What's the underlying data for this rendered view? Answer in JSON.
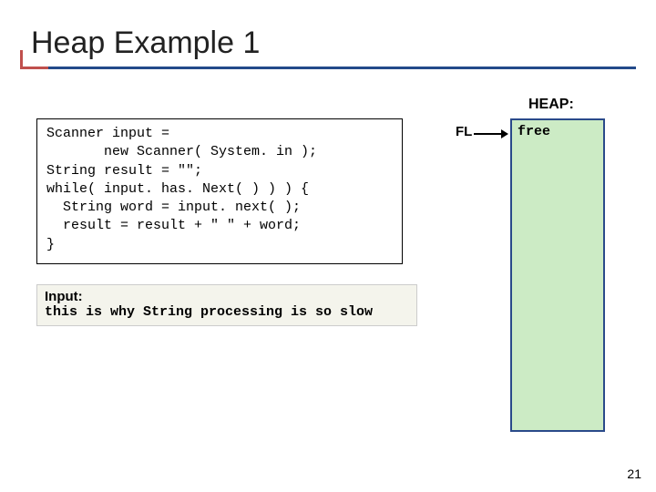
{
  "title": "Heap Example 1",
  "code": {
    "l1": "Scanner input = ",
    "l2": "       new Scanner( System. in );",
    "l3": "String result = \"\";",
    "l4": "while( input. has. Next( ) ) ) {",
    "l5": "  String word = input. next( );",
    "l6": "  result = result + \" \" + word;",
    "l7": "}"
  },
  "input": {
    "label": "Input:",
    "text": "this is why String processing is so slow"
  },
  "heap": {
    "title": "HEAP:",
    "cell": "free"
  },
  "pointer": {
    "label": "FL"
  },
  "page": "21"
}
